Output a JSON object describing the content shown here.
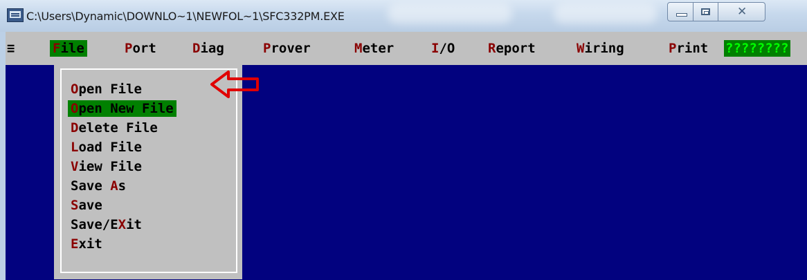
{
  "window": {
    "title": "C:\\Users\\Dynamic\\DOWNLO~1\\NEWFOL~1\\SFC332PM.EXE"
  },
  "menubar": {
    "system_glyph": "≡",
    "items": [
      {
        "hotkey": "F",
        "rest": "ile"
      },
      {
        "hotkey": "P",
        "rest": "ort"
      },
      {
        "hotkey": "D",
        "rest": "iag"
      },
      {
        "hotkey": "P",
        "rest": "rover"
      },
      {
        "hotkey": "M",
        "rest": "eter"
      },
      {
        "hotkey": "I",
        "rest": "/O"
      },
      {
        "hotkey": "R",
        "rest": "eport"
      },
      {
        "hotkey": "W",
        "rest": "iring"
      },
      {
        "hotkey": "P",
        "rest": "rint"
      }
    ],
    "help_label": "????????",
    "active_index": 0
  },
  "file_menu": {
    "selected_index": 1,
    "items": [
      {
        "pre": "",
        "hotkey": "O",
        "post": "pen File"
      },
      {
        "pre": "",
        "hotkey": "O",
        "post": "pen New File"
      },
      {
        "pre": "",
        "hotkey": "D",
        "post": "elete File"
      },
      {
        "pre": "",
        "hotkey": "L",
        "post": "oad File"
      },
      {
        "pre": "",
        "hotkey": "V",
        "post": "iew File"
      },
      {
        "pre": "Save ",
        "hotkey": "A",
        "post": "s"
      },
      {
        "pre": "",
        "hotkey": "S",
        "post": "ave"
      },
      {
        "pre": "Save/E",
        "hotkey": "X",
        "post": "it"
      },
      {
        "pre": "",
        "hotkey": "E",
        "post": "xit"
      }
    ]
  },
  "colors": {
    "console_background": "#02027f",
    "menu_background": "#c0c0c0",
    "hotkey": "#8a0000",
    "highlight": "#008000",
    "annotation_arrow": "#e00000"
  },
  "icons": {
    "app": "console-app-icon",
    "minimize": "minimize-icon",
    "maximize": "maximize-icon",
    "close": "close-icon",
    "annotation": "left-arrow-annotation"
  }
}
